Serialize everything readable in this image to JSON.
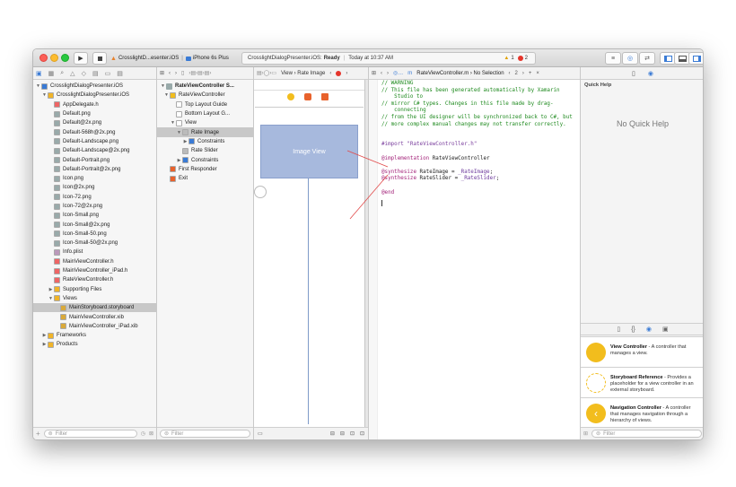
{
  "toolbar": {
    "scheme_app": "CrosslightD...esenter.iOS",
    "scheme_device": "iPhone 6s Plus",
    "status_project": "CrosslightDialogPresenter.iOS:",
    "status_state": "Ready",
    "status_time": "Today at 10:37 AM",
    "warnings": "1",
    "errors": "2"
  },
  "navigator": {
    "rows": [
      {
        "label": "CrosslightDialogPresenter.iOS",
        "indent": 0,
        "tri": "▼",
        "color": "#3a7bd5"
      },
      {
        "label": "CrosslightDialogPresenter.iOS",
        "indent": 1,
        "tri": "▼",
        "color": "#f0b429"
      },
      {
        "label": "AppDelegate.h",
        "indent": 2,
        "tri": "",
        "color": "#e66"
      },
      {
        "label": "Default.png",
        "indent": 2,
        "tri": "",
        "color": "#9aa"
      },
      {
        "label": "Default@2x.png",
        "indent": 2,
        "tri": "",
        "color": "#9aa"
      },
      {
        "label": "Default-568h@2x.png",
        "indent": 2,
        "tri": "",
        "color": "#9aa"
      },
      {
        "label": "Default-Landscape.png",
        "indent": 2,
        "tri": "",
        "color": "#9aa"
      },
      {
        "label": "Default-Landscape@2x.png",
        "indent": 2,
        "tri": "",
        "color": "#9aa"
      },
      {
        "label": "Default-Portrait.png",
        "indent": 2,
        "tri": "",
        "color": "#9aa"
      },
      {
        "label": "Default-Portrait@2x.png",
        "indent": 2,
        "tri": "",
        "color": "#9aa"
      },
      {
        "label": "Icon.png",
        "indent": 2,
        "tri": "",
        "color": "#9aa"
      },
      {
        "label": "Icon@2x.png",
        "indent": 2,
        "tri": "",
        "color": "#9aa"
      },
      {
        "label": "Icon-72.png",
        "indent": 2,
        "tri": "",
        "color": "#9aa"
      },
      {
        "label": "Icon-72@2x.png",
        "indent": 2,
        "tri": "",
        "color": "#9aa"
      },
      {
        "label": "Icon-Small.png",
        "indent": 2,
        "tri": "",
        "color": "#9aa"
      },
      {
        "label": "Icon-Small@2x.png",
        "indent": 2,
        "tri": "",
        "color": "#9aa"
      },
      {
        "label": "Icon-Small-50.png",
        "indent": 2,
        "tri": "",
        "color": "#9aa"
      },
      {
        "label": "Icon-Small-50@2x.png",
        "indent": 2,
        "tri": "",
        "color": "#9aa"
      },
      {
        "label": "Info.plist",
        "indent": 2,
        "tri": "",
        "color": "#b9b"
      },
      {
        "label": "MainViewController.h",
        "indent": 2,
        "tri": "",
        "color": "#e66"
      },
      {
        "label": "MainViewController_iPad.h",
        "indent": 2,
        "tri": "",
        "color": "#e66"
      },
      {
        "label": "RateViewController.h",
        "indent": 2,
        "tri": "",
        "color": "#e66"
      },
      {
        "label": "Supporting Files",
        "indent": 2,
        "tri": "▶",
        "color": "#f0b429"
      },
      {
        "label": "Views",
        "indent": 2,
        "tri": "▼",
        "color": "#f0b429"
      },
      {
        "label": "MainStoryboard.storyboard",
        "indent": 3,
        "tri": "",
        "color": "#d9a93a",
        "selected": true
      },
      {
        "label": "MainViewController.xib",
        "indent": 3,
        "tri": "",
        "color": "#d9a93a"
      },
      {
        "label": "MainViewController_iPad.xib",
        "indent": 3,
        "tri": "",
        "color": "#d9a93a"
      },
      {
        "label": "Frameworks",
        "indent": 1,
        "tri": "▶",
        "color": "#f0b429"
      },
      {
        "label": "Products",
        "indent": 1,
        "tri": "▶",
        "color": "#f0b429"
      }
    ],
    "filter_placeholder": "Filter"
  },
  "outline": {
    "header": "RateViewController S...",
    "rows": [
      {
        "label": "RateViewController",
        "indent": 1,
        "tri": "▼",
        "color": "#f2bd1d"
      },
      {
        "label": "Top Layout Guide",
        "indent": 2,
        "tri": "",
        "color": "#fff"
      },
      {
        "label": "Bottom Layout G...",
        "indent": 2,
        "tri": "",
        "color": "#fff"
      },
      {
        "label": "View",
        "indent": 2,
        "tri": "▼",
        "color": "#fff"
      },
      {
        "label": "Rate Image",
        "indent": 3,
        "tri": "▼",
        "color": "#bbb",
        "selected": true
      },
      {
        "label": "Constraints",
        "indent": 4,
        "tri": "▶",
        "color": "#3a7bd5"
      },
      {
        "label": "Rate Slider",
        "indent": 3,
        "tri": "",
        "color": "#bbb"
      },
      {
        "label": "Constraints",
        "indent": 3,
        "tri": "▶",
        "color": "#3a7bd5"
      },
      {
        "label": "First Responder",
        "indent": 1,
        "tri": "",
        "color": "#e8622c"
      },
      {
        "label": "Exit",
        "indent": 1,
        "tri": "",
        "color": "#e8622c"
      }
    ],
    "filter_placeholder": "Filter"
  },
  "canvas": {
    "jump": "View  ›  Rate Image",
    "image_view_label": "Image View"
  },
  "editor": {
    "jump": "RateViewController.m  ›  No Selection",
    "counter": "2",
    "lines": [
      [
        {
          "t": "// WARNING",
          "c": "cm"
        }
      ],
      [
        {
          "t": "// This file has been generated automatically by Xamarin",
          "c": "cm"
        }
      ],
      [
        {
          "t": "    Studio to",
          "c": "cm"
        }
      ],
      [
        {
          "t": "// mirror C# types. Changes in this file made by drag-",
          "c": "cm"
        }
      ],
      [
        {
          "t": "    connecting",
          "c": "cm"
        }
      ],
      [
        {
          "t": "// from the UI designer will be synchronized back to C#, but",
          "c": "cm"
        }
      ],
      [
        {
          "t": "// more complex manual changes may not transfer correctly.",
          "c": "cm"
        }
      ],
      [
        {
          "t": "",
          "c": "pl"
        }
      ],
      [
        {
          "t": "",
          "c": "pl"
        }
      ],
      [
        {
          "t": "#import \"RateViewController.h\"",
          "c": "pp"
        }
      ],
      [
        {
          "t": "",
          "c": "pl"
        }
      ],
      [
        {
          "t": "@implementation",
          "c": "kw"
        },
        {
          "t": " RateViewController",
          "c": "pl"
        }
      ],
      [
        {
          "t": "",
          "c": "pl"
        }
      ],
      [
        {
          "t": "@synthesize",
          "c": "kw"
        },
        {
          "t": " RateImage = ",
          "c": "pl"
        },
        {
          "t": "_RateImage",
          "c": "ct"
        },
        {
          "t": ";",
          "c": "pl"
        }
      ],
      [
        {
          "t": "@synthesize",
          "c": "kw"
        },
        {
          "t": " RateSlider = ",
          "c": "pl"
        },
        {
          "t": "_RateSlider",
          "c": "ct"
        },
        {
          "t": ";",
          "c": "pl"
        }
      ],
      [
        {
          "t": "",
          "c": "pl"
        }
      ],
      [
        {
          "t": "@end",
          "c": "kw"
        }
      ]
    ]
  },
  "inspector": {
    "header": "Quick Help",
    "empty": "No Quick Help",
    "library": [
      {
        "title": "View Controller",
        "desc": " - A controller that manages a view."
      },
      {
        "title": "Storyboard Reference",
        "desc": " - Provides a placeholder for a view controller in an external storyboard."
      },
      {
        "title": "Navigation Controller",
        "desc": " - A controller that manages navigation through a hierarchy of views."
      }
    ],
    "filter_placeholder": "Filter"
  }
}
